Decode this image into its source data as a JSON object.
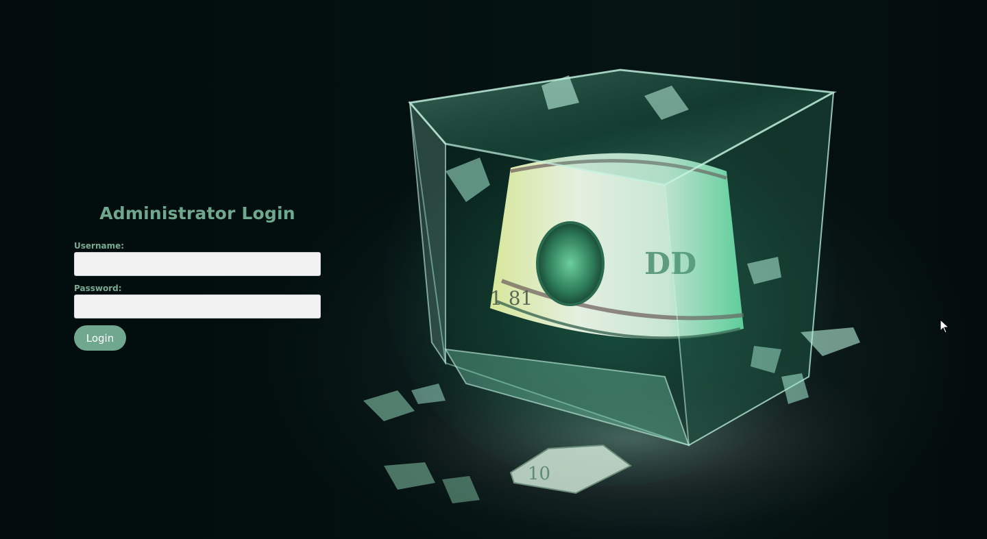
{
  "login": {
    "title": "Administrator Login",
    "username_label": "Username:",
    "username_value": "",
    "password_label": "Password:",
    "password_value": "",
    "submit_label": "Login"
  },
  "hero": {
    "icon": "shattered-glass-cube-with-dollar-bills-image"
  },
  "colors": {
    "accent": "#6fa88e",
    "background": "#020b0b",
    "input_background": "#f2f2f2"
  }
}
